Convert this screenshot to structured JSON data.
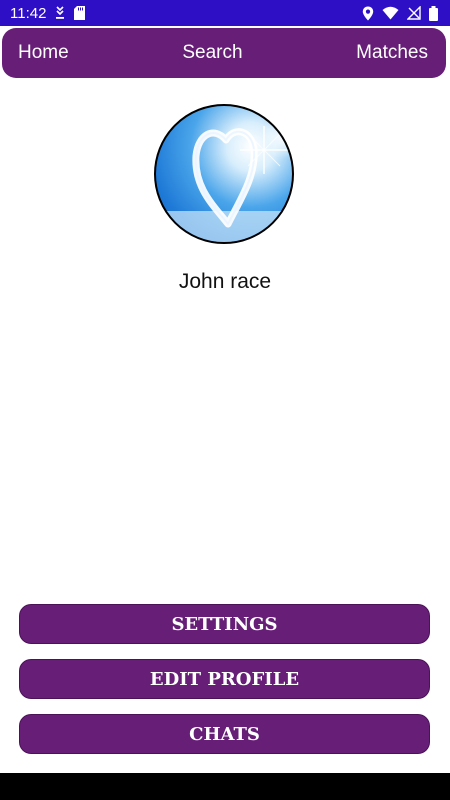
{
  "status_bar": {
    "time": "11:42",
    "icons": [
      "download-icon",
      "sd-card-icon",
      "location-icon",
      "wifi-icon",
      "no-signal-icon",
      "battery-icon"
    ]
  },
  "nav": {
    "home": "Home",
    "search": "Search",
    "matches": "Matches"
  },
  "profile": {
    "avatar": "heart-cloud-sky-image",
    "name": "John race"
  },
  "actions": {
    "settings": "SETTINGS",
    "edit_profile": "EDIT PROFILE",
    "chats": "CHATS"
  },
  "colors": {
    "status_bar": "#2e0fc6",
    "accent": "#661e76",
    "background": "#ffffff",
    "button_text": "#ffffff"
  }
}
